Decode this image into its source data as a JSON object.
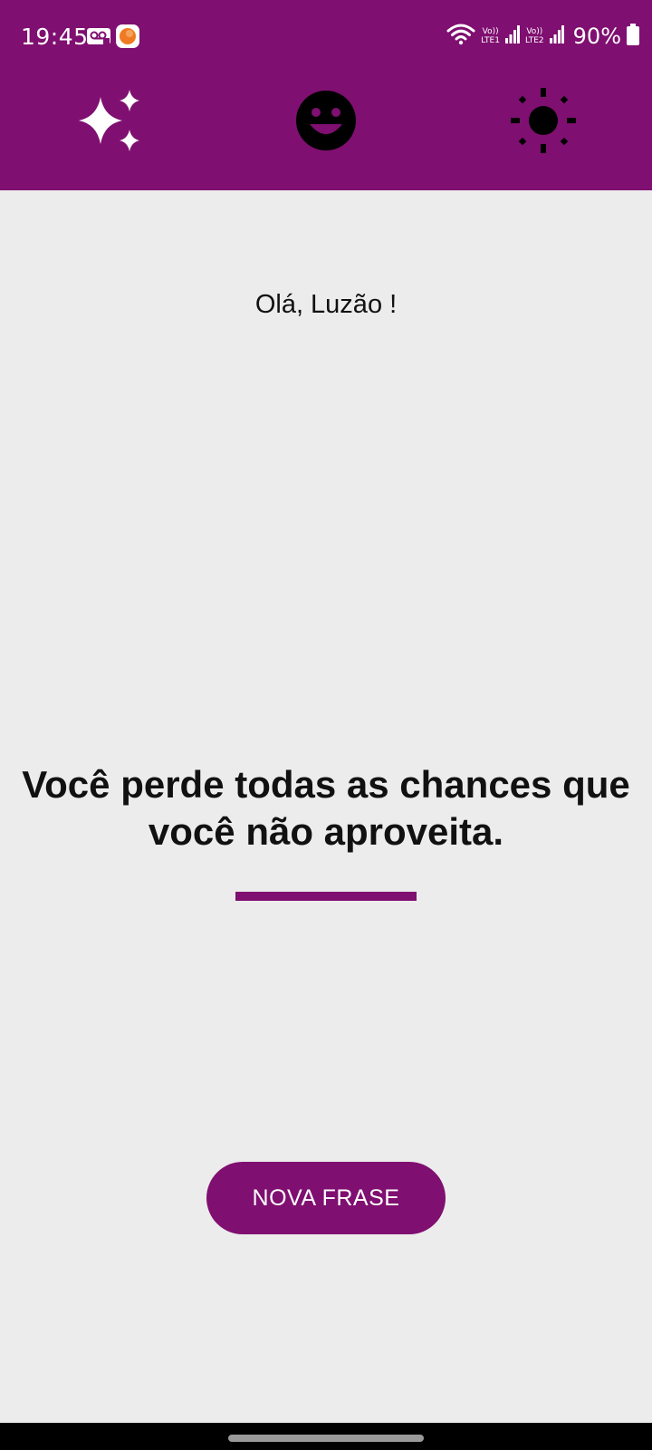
{
  "status_bar": {
    "time": "19:45",
    "left_icons": [
      "voicemail-icon",
      "app-notification-icon"
    ],
    "sim1_label_top": "Vo))",
    "sim1_label_bottom": "LTE1",
    "sim2_label_top": "Vo))",
    "sim2_label_bottom": "LTE2",
    "battery_pct": "90%"
  },
  "app_bar": {
    "background": "#7f0f70",
    "icons": [
      "sparkle-icon",
      "smile-icon",
      "sun-icon"
    ]
  },
  "main": {
    "greeting": "Olá, Luzão !",
    "quote": "Você perde todas as chances que você não aproveita.",
    "accent": "#7f0f70"
  },
  "actions": {
    "new_phrase_label": "NOVA FRASE"
  }
}
